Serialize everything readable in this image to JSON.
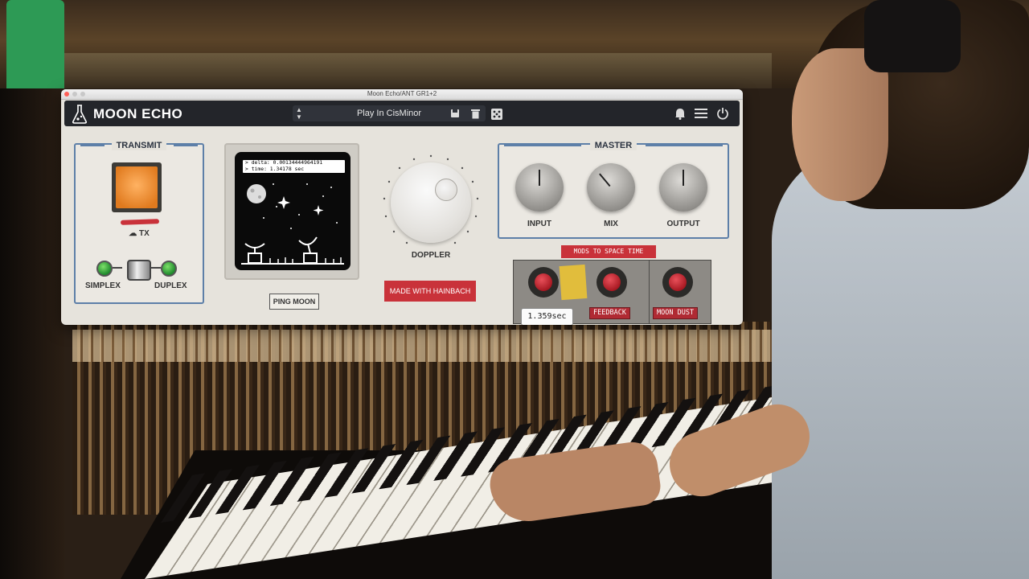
{
  "window": {
    "title": "Moon Echo/ANT GR1+2"
  },
  "toolbar": {
    "app_name": "MOON ECHO",
    "preset_name": "Play In CisMinor",
    "icons": [
      "flask-logo-icon",
      "preset-arrows-icon",
      "save-icon",
      "trash-icon",
      "dice-icon",
      "bell-icon",
      "menu-icon",
      "power-icon"
    ]
  },
  "transmit": {
    "title": "TRANSMIT",
    "tx_label": "☁ TX",
    "simplex_label": "SIMPLEX",
    "duplex_label": "DUPLEX"
  },
  "scope": {
    "readout_line1": "> delta: 0.00134444964191",
    "readout_line2": "> time: 1.34178 sec",
    "ping_button": "PING MOON"
  },
  "doppler": {
    "label": "DOPPLER"
  },
  "hainbach_button": "MADE WITH HAINBACH",
  "master": {
    "title": "MASTER",
    "knobs": [
      {
        "label": "INPUT"
      },
      {
        "label": "MIX"
      },
      {
        "label": "OUTPUT"
      }
    ]
  },
  "mods": {
    "title": "MODS TO SPACE TIME",
    "feedback_label": "FEEDBACK",
    "moon_dust_label": "MOON DUST",
    "tooltip_value": "1.359sec"
  },
  "colors": {
    "accent_blue": "#5d7fa8",
    "accent_red": "#c9323a",
    "toolbar_dark": "#23252a",
    "led_green": "#2fa03c",
    "tx_orange": "#f08a28"
  }
}
